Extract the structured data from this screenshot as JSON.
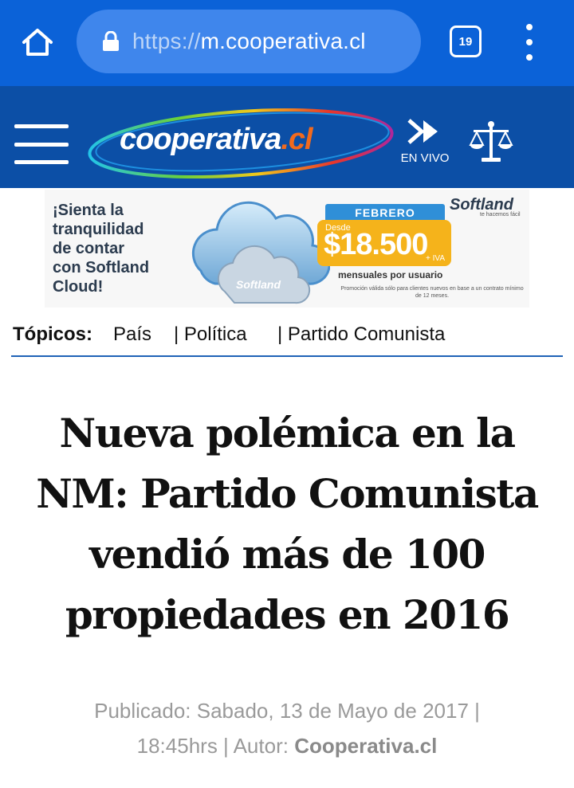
{
  "browser": {
    "url_scheme": "https://",
    "url_host": "m.cooperativa.cl",
    "tab_count": "19",
    "home_icon": "home-icon",
    "lock_icon": "lock-icon",
    "menu_icon": "more-vert-icon"
  },
  "site": {
    "logo_main": "cooperativa",
    "logo_tld": ".cl",
    "live_label": "EN VIVO",
    "menu_icon": "hamburger-icon",
    "justice_icon": "scales-icon",
    "header_color": "#0c4fa6"
  },
  "ad": {
    "lines": [
      "¡Sienta la",
      "tranquilidad",
      "de contar",
      "con Softland",
      "Cloud!"
    ],
    "month": "FEBRERO",
    "desde": "Desde",
    "price": "$18.500",
    "iva": "+ IVA",
    "monthly": "mensuales por usuario",
    "fine_print": "Promoción válida sólo para clientes nuevos en base a un contrato mínimo de 12 meses.",
    "brand": "Softland",
    "tagline": "te hacemos fácil",
    "cloud_label": "Softland"
  },
  "topics": {
    "label": "Tópicos:",
    "items": [
      "País",
      "| Política",
      "| Partido Comunista"
    ]
  },
  "article": {
    "headline_lines": [
      "Nueva polémica en la",
      "NM: Partido Comunista",
      "vendió más de 100",
      "propiedades en 2016"
    ],
    "byline_line1": "Publicado: Sabado, 13 de Mayo de 2017 |",
    "byline_line2_prefix": "18:45hrs | Autor: ",
    "author": "Cooperativa.cl"
  }
}
